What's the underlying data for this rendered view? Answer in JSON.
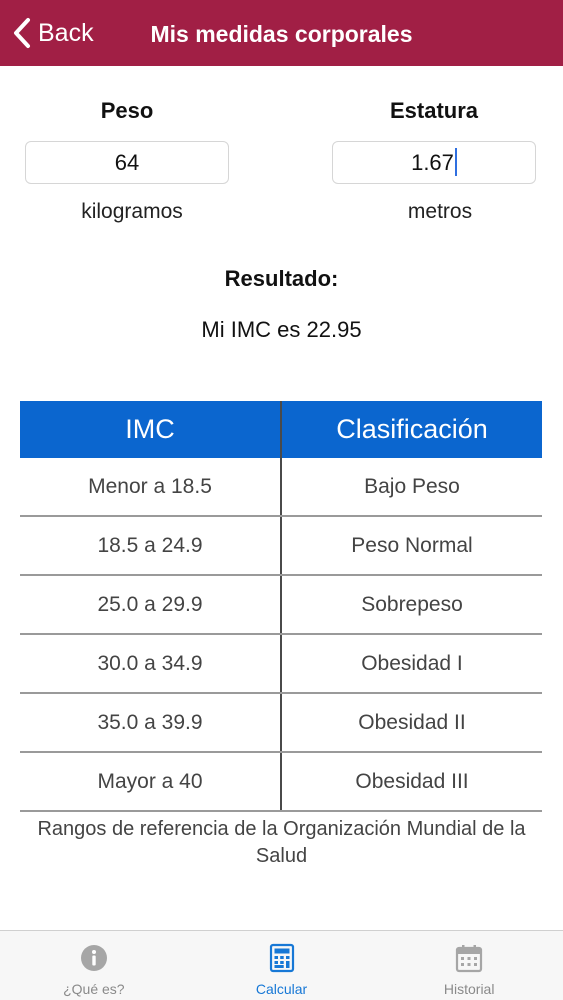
{
  "nav": {
    "back_label": "Back",
    "title": "Mis medidas corporales"
  },
  "form": {
    "weight": {
      "label": "Peso",
      "value": "64",
      "unit": "kilogramos"
    },
    "height": {
      "label": "Estatura",
      "value": "1.67",
      "unit": "metros"
    }
  },
  "result": {
    "title": "Resultado:",
    "text": "Mi IMC es 22.95"
  },
  "table": {
    "headers": [
      "IMC",
      "Clasificación"
    ],
    "rows": [
      [
        "Menor a 18.5",
        "Bajo Peso"
      ],
      [
        "18.5 a 24.9",
        "Peso Normal"
      ],
      [
        "25.0 a 29.9",
        "Sobrepeso"
      ],
      [
        "30.0 a 34.9",
        "Obesidad I"
      ],
      [
        "35.0 a 39.9",
        "Obesidad II"
      ],
      [
        "Mayor a 40",
        "Obesidad III"
      ]
    ],
    "note": "Rangos de referencia de la Organización Mundial de la Salud"
  },
  "tabs": [
    {
      "label": "¿Qué es?",
      "icon": "info-icon",
      "active": false
    },
    {
      "label": "Calcular",
      "icon": "calculator-icon",
      "active": true
    },
    {
      "label": "Historial",
      "icon": "calendar-icon",
      "active": false
    }
  ],
  "colors": {
    "nav_bg": "#a11f45",
    "table_header": "#0b66cf",
    "active_tab": "#1778d6"
  }
}
